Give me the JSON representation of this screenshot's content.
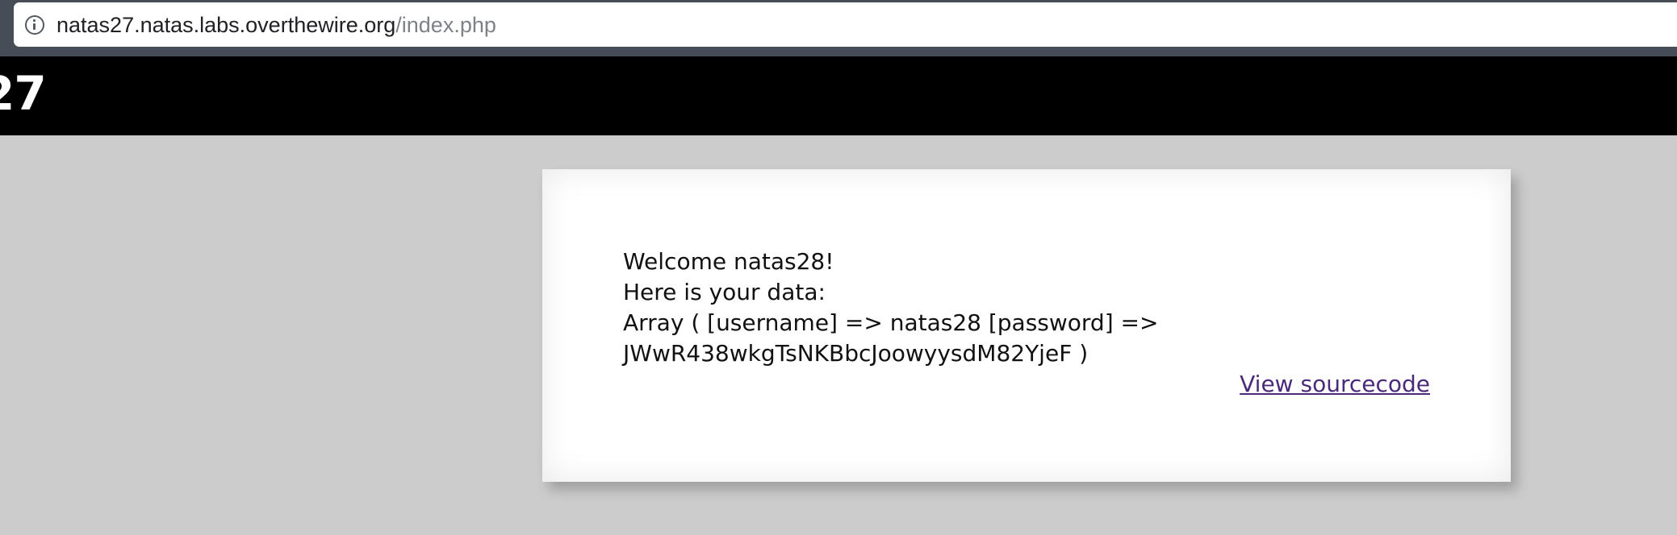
{
  "browser": {
    "url_host": "natas27.natas.labs.overthewire.org",
    "url_path": "/index.php"
  },
  "header": {
    "title_fragment": "27"
  },
  "content": {
    "lines": [
      "Welcome natas28!",
      "Here is your data:",
      "Array ( [username] => natas28 [password] =>",
      "JWwR438wkgTsNKBbcJoowyysdM82YjeF )"
    ],
    "source_link": "View sourcecode"
  },
  "colors": {
    "chrome": "#474d57",
    "header_bg": "#000000",
    "page_bg": "#cccccc",
    "link": "#4b2a7b"
  },
  "icons": {
    "address_bar_icon": "info-icon"
  }
}
